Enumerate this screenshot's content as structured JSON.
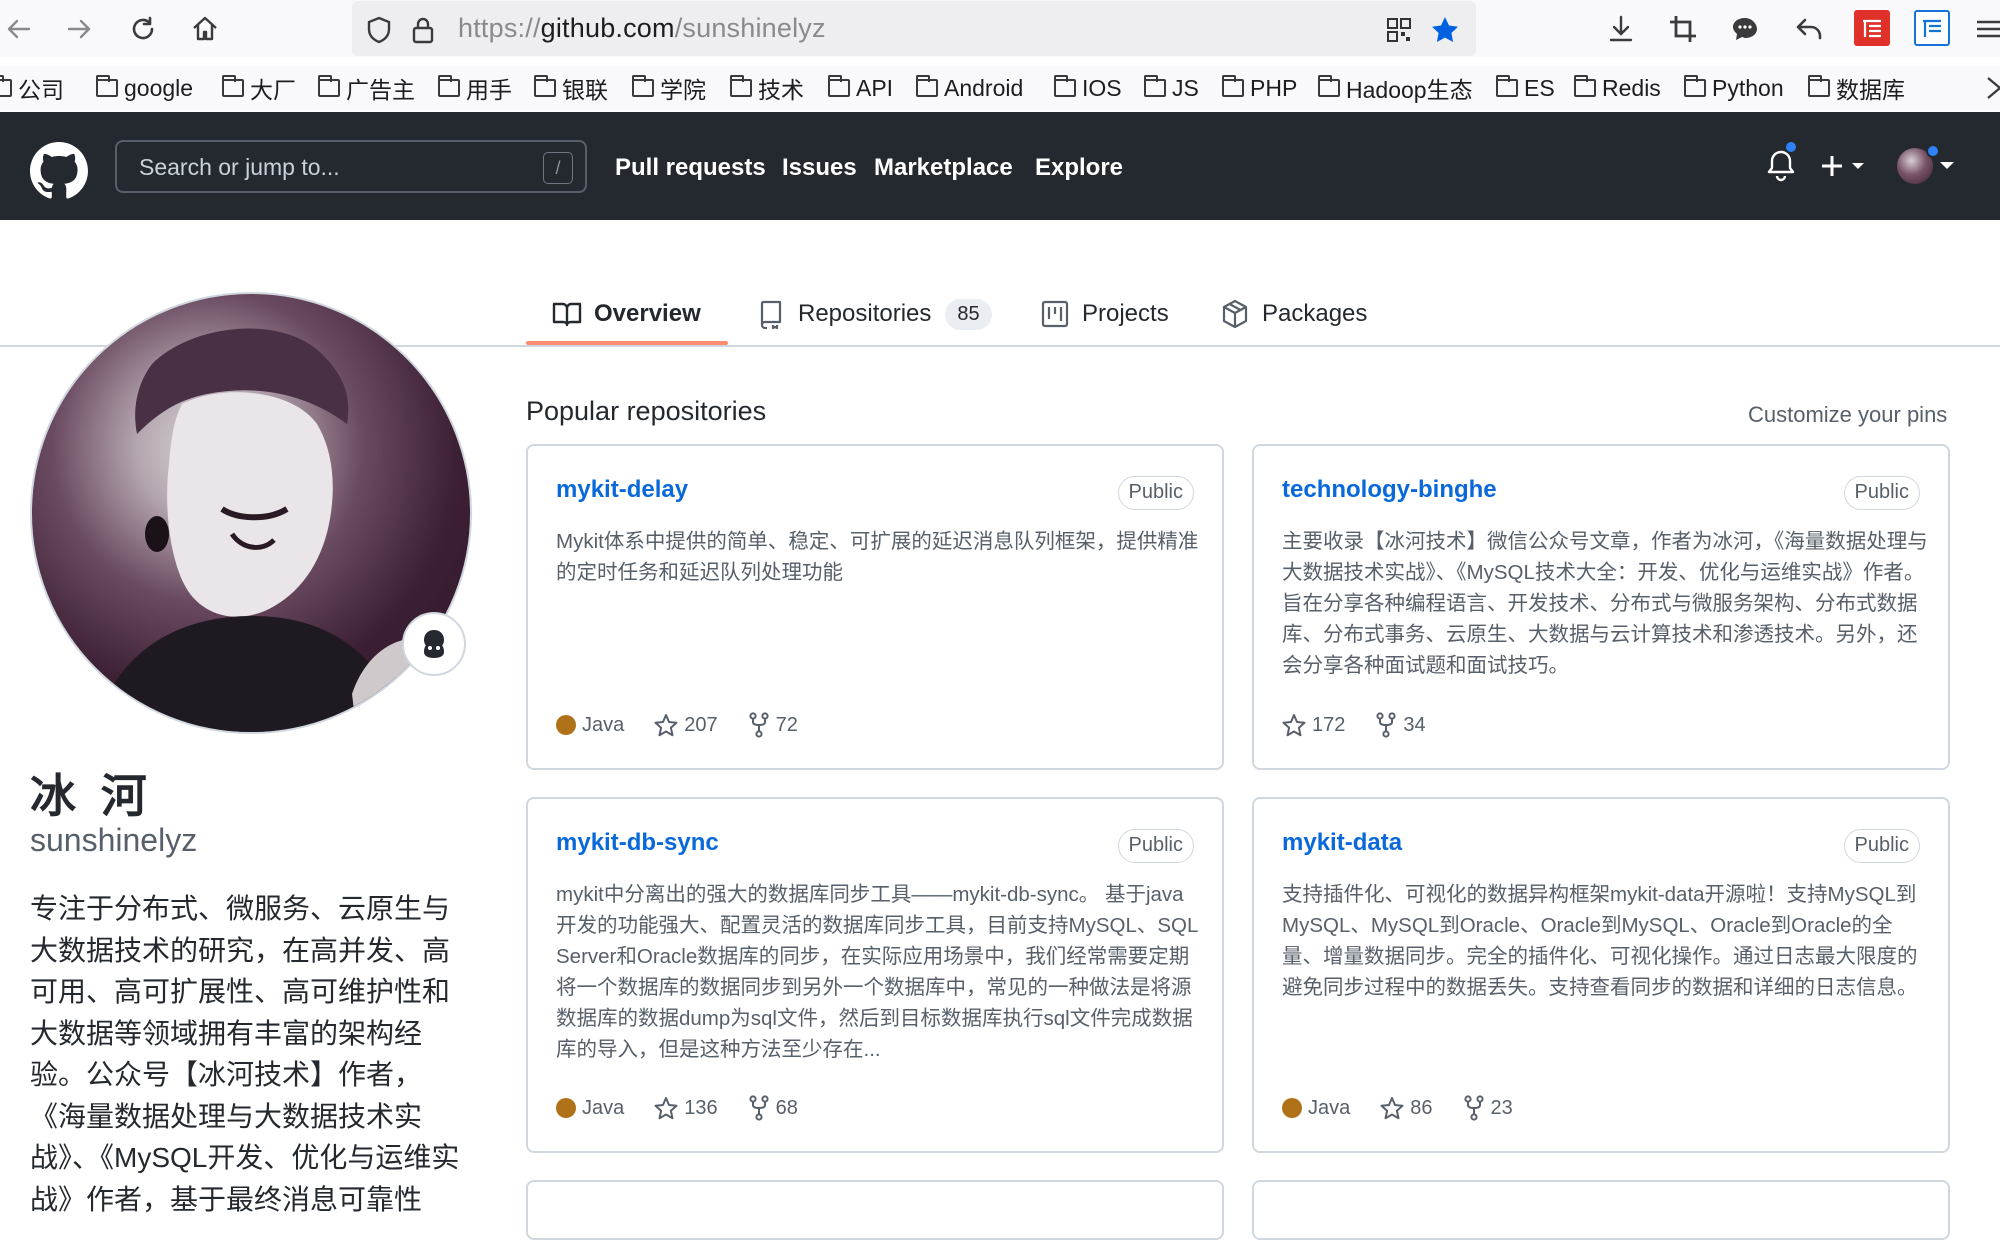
{
  "browser": {
    "url_scheme": "https://",
    "url_host": "github.com",
    "url_path": "/sunshinelyz",
    "bookmarks": [
      "公司",
      "google",
      "大厂",
      "广告主",
      "用手",
      "银联",
      "学院",
      "技术",
      "API",
      "Android",
      "IOS",
      "JS",
      "PHP",
      "Hadoop生态",
      "ES",
      "Redis",
      "Python",
      "数据库"
    ]
  },
  "header": {
    "search_placeholder": "Search or jump to...",
    "search_shortcut": "/",
    "nav": [
      "Pull requests",
      "Issues",
      "Marketplace",
      "Explore"
    ]
  },
  "tabs": [
    {
      "label": "Overview",
      "icon": "book-icon"
    },
    {
      "label": "Repositories",
      "icon": "repo-icon",
      "count": "85"
    },
    {
      "label": "Projects",
      "icon": "project-icon"
    },
    {
      "label": "Packages",
      "icon": "package-icon"
    }
  ],
  "profile": {
    "name": "冰 河",
    "login": "sunshinelyz",
    "bio": "专注于分布式、微服务、云原生与大数据技术的研究，在高并发、高可用、高可扩展性、高可维护性和大数据等领域拥有丰富的架构经验。公众号【冰河技术】作者，《海量数据处理与大数据技术实战》、《MySQL开发、优化与运维实战》作者，基于最终消息可靠性"
  },
  "popular": {
    "title": "Popular repositories",
    "customize": "Customize your pins",
    "repos": [
      {
        "name": "mykit-delay",
        "visibility": "Public",
        "description": "Mykit体系中提供的简单、稳定、可扩展的延迟消息队列框架，提供精准的定时任务和延迟队列处理功能",
        "language": "Java",
        "stars": "207",
        "forks": "72"
      },
      {
        "name": "technology-binghe",
        "visibility": "Public",
        "description": "主要收录【冰河技术】微信公众号文章，作者为冰河，《海量数据处理与大数据技术实战》、《MySQL技术大全：开发、优化与运维实战》作者。旨在分享各种编程语言、开发技术、分布式与微服务架构、分布式数据库、分布式事务、云原生、大数据与云计算技术和渗透技术。另外，还会分享各种面试题和面试技巧。",
        "language": "",
        "stars": "172",
        "forks": "34"
      },
      {
        "name": "mykit-db-sync",
        "visibility": "Public",
        "description": "mykit中分离出的强大的数据库同步工具——mykit-db-sync。 基于java开发的功能强大、配置灵活的数据库同步工具，目前支持MySQL、SQL Server和Oracle数据库的同步，在实际应用场景中，我们经常需要定期将一个数据库的数据同步到另外一个数据库中，常见的一种做法是将源数据库的数据dump为sql文件，然后到目标数据库执行sql文件完成数据库的导入，但是这种方法至少存在...",
        "language": "Java",
        "stars": "136",
        "forks": "68"
      },
      {
        "name": "mykit-data",
        "visibility": "Public",
        "description": "支持插件化、可视化的数据异构框架mykit-data开源啦！支持MySQL到MySQL、MySQL到Oracle、Oracle到MySQL、Oracle到Oracle的全量、增量数据同步。完全的插件化、可视化操作。通过日志最大限度的避免同步过程中的数据丢失。支持查看同步的数据和详细的日志信息。",
        "language": "Java",
        "stars": "86",
        "forks": "23"
      }
    ]
  }
}
